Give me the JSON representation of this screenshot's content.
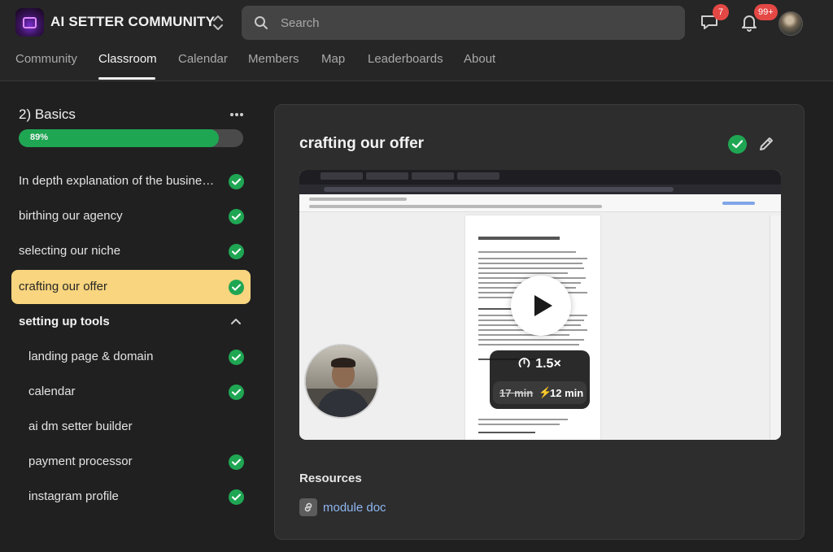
{
  "header": {
    "community_name": "AI SETTER COMMUNITY",
    "search_placeholder": "Search",
    "chat_badge": "7",
    "notifications_badge": "99+"
  },
  "nav": {
    "tabs": [
      "Community",
      "Classroom",
      "Calendar",
      "Members",
      "Map",
      "Leaderboards",
      "About"
    ],
    "active": "Classroom"
  },
  "sidebar": {
    "course_title": "2) Basics",
    "progress_label": "89%",
    "progress_value": 0.89,
    "lessons": [
      {
        "label": "In depth explanation of the business...",
        "completed": true
      },
      {
        "label": "birthing our agency",
        "completed": true
      },
      {
        "label": "selecting our niche",
        "completed": true
      },
      {
        "label": "crafting our offer",
        "completed": true,
        "active": true
      }
    ],
    "section": {
      "title": "setting up tools",
      "expanded": true,
      "lessons": [
        {
          "label": "landing page & domain",
          "completed": true
        },
        {
          "label": "calendar",
          "completed": true
        },
        {
          "label": "ai dm setter builder",
          "completed": false
        },
        {
          "label": "payment processor",
          "completed": true
        },
        {
          "label": "instagram profile",
          "completed": true
        }
      ]
    }
  },
  "main": {
    "lesson_title": "crafting our offer",
    "video": {
      "speed": "1.5×",
      "original_time": "17 min",
      "new_time": "12 min"
    },
    "resources_title": "Resources",
    "resources": [
      {
        "label": "module doc"
      }
    ]
  },
  "colors": {
    "accent_green": "#1fa653",
    "active_lesson": "#f8d57e",
    "badge_red": "#e44845",
    "link_blue": "#8fb6f2"
  }
}
